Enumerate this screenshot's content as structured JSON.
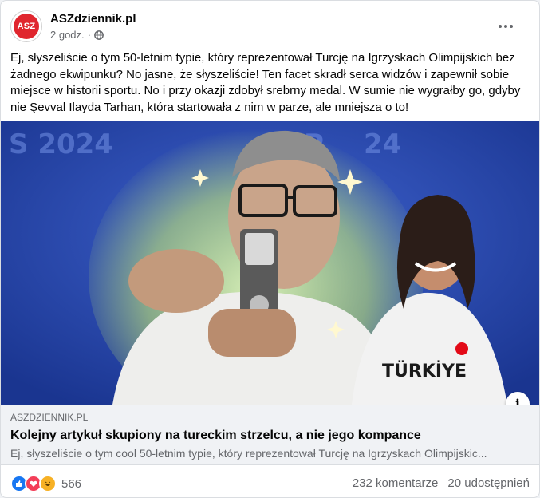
{
  "post": {
    "page_name": "ASZdziennik.pl",
    "avatar_text": "ASZ",
    "time": "2 godz.",
    "separator": "·",
    "text": "Ej, słyszeliście o tym 50-letnim typie, który reprezentował Turcję na Igrzyskach Olimpijskich bez żadnego ekwipunku? No jasne, że słyszeliście! Ten facet skradł serca widzów i zapewnił sobie miejsce w historii sportu. No i przy okazji zdobył srebrny medal. W sumie nie wygrałby go, gdyby nie Şevval Ilayda Tarhan, która startowała z nim w parze, ale mniejsza o to!"
  },
  "image": {
    "background_text_left": "S 2024",
    "background_text_right": "P",
    "background_text_right2": "24",
    "shirt_text": "TÜRKİYE",
    "info_label": "i"
  },
  "link": {
    "domain": "ASZDZIENNIK.PL",
    "title": "Kolejny artykuł skupiony na tureckim strzelcu, a nie jego kompance",
    "description": "Ej, słyszeliście o tym cool 50-letnim typie, który reprezentował Turcję na Igrzyskach Olimpijskic..."
  },
  "footer": {
    "reaction_count": "566",
    "comments": "232 komentarze",
    "shares": "20 udostępnień"
  },
  "icons": {
    "avatar": "asz-logo-icon",
    "audience": "globe-icon",
    "more": "more-options-icon",
    "like": "like-icon",
    "love": "love-icon",
    "haha": "haha-icon",
    "info": "info-icon"
  },
  "colors": {
    "brand_red": "#e0262e",
    "like_blue": "#1877f2",
    "love_red": "#f33e58",
    "haha_yellow": "#f7b125",
    "secondary_text": "#65676b"
  }
}
